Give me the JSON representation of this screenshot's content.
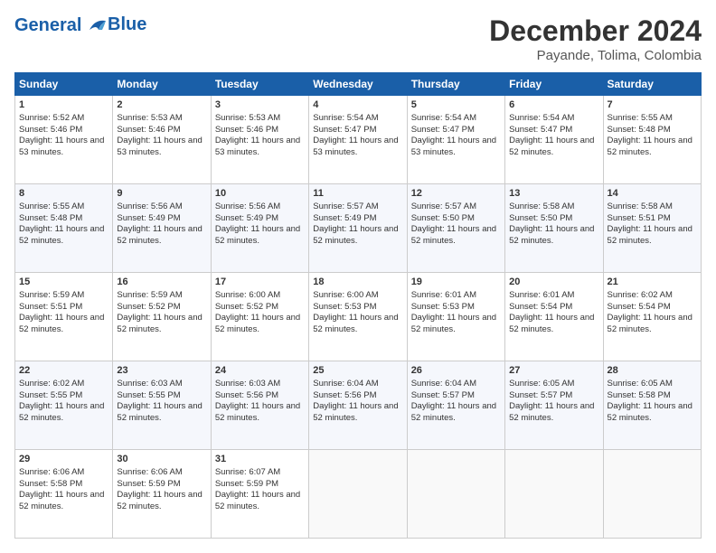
{
  "header": {
    "logo_line1": "General",
    "logo_line2": "Blue",
    "title": "December 2024",
    "subtitle": "Payande, Tolima, Colombia"
  },
  "days_of_week": [
    "Sunday",
    "Monday",
    "Tuesday",
    "Wednesday",
    "Thursday",
    "Friday",
    "Saturday"
  ],
  "weeks": [
    [
      {
        "day": "1",
        "sunrise": "5:52 AM",
        "sunset": "5:46 PM",
        "daylight": "11 hours and 53 minutes."
      },
      {
        "day": "2",
        "sunrise": "5:53 AM",
        "sunset": "5:46 PM",
        "daylight": "11 hours and 53 minutes."
      },
      {
        "day": "3",
        "sunrise": "5:53 AM",
        "sunset": "5:46 PM",
        "daylight": "11 hours and 53 minutes."
      },
      {
        "day": "4",
        "sunrise": "5:54 AM",
        "sunset": "5:47 PM",
        "daylight": "11 hours and 53 minutes."
      },
      {
        "day": "5",
        "sunrise": "5:54 AM",
        "sunset": "5:47 PM",
        "daylight": "11 hours and 53 minutes."
      },
      {
        "day": "6",
        "sunrise": "5:54 AM",
        "sunset": "5:47 PM",
        "daylight": "11 hours and 52 minutes."
      },
      {
        "day": "7",
        "sunrise": "5:55 AM",
        "sunset": "5:48 PM",
        "daylight": "11 hours and 52 minutes."
      }
    ],
    [
      {
        "day": "8",
        "sunrise": "5:55 AM",
        "sunset": "5:48 PM",
        "daylight": "11 hours and 52 minutes."
      },
      {
        "day": "9",
        "sunrise": "5:56 AM",
        "sunset": "5:49 PM",
        "daylight": "11 hours and 52 minutes."
      },
      {
        "day": "10",
        "sunrise": "5:56 AM",
        "sunset": "5:49 PM",
        "daylight": "11 hours and 52 minutes."
      },
      {
        "day": "11",
        "sunrise": "5:57 AM",
        "sunset": "5:49 PM",
        "daylight": "11 hours and 52 minutes."
      },
      {
        "day": "12",
        "sunrise": "5:57 AM",
        "sunset": "5:50 PM",
        "daylight": "11 hours and 52 minutes."
      },
      {
        "day": "13",
        "sunrise": "5:58 AM",
        "sunset": "5:50 PM",
        "daylight": "11 hours and 52 minutes."
      },
      {
        "day": "14",
        "sunrise": "5:58 AM",
        "sunset": "5:51 PM",
        "daylight": "11 hours and 52 minutes."
      }
    ],
    [
      {
        "day": "15",
        "sunrise": "5:59 AM",
        "sunset": "5:51 PM",
        "daylight": "11 hours and 52 minutes."
      },
      {
        "day": "16",
        "sunrise": "5:59 AM",
        "sunset": "5:52 PM",
        "daylight": "11 hours and 52 minutes."
      },
      {
        "day": "17",
        "sunrise": "6:00 AM",
        "sunset": "5:52 PM",
        "daylight": "11 hours and 52 minutes."
      },
      {
        "day": "18",
        "sunrise": "6:00 AM",
        "sunset": "5:53 PM",
        "daylight": "11 hours and 52 minutes."
      },
      {
        "day": "19",
        "sunrise": "6:01 AM",
        "sunset": "5:53 PM",
        "daylight": "11 hours and 52 minutes."
      },
      {
        "day": "20",
        "sunrise": "6:01 AM",
        "sunset": "5:54 PM",
        "daylight": "11 hours and 52 minutes."
      },
      {
        "day": "21",
        "sunrise": "6:02 AM",
        "sunset": "5:54 PM",
        "daylight": "11 hours and 52 minutes."
      }
    ],
    [
      {
        "day": "22",
        "sunrise": "6:02 AM",
        "sunset": "5:55 PM",
        "daylight": "11 hours and 52 minutes."
      },
      {
        "day": "23",
        "sunrise": "6:03 AM",
        "sunset": "5:55 PM",
        "daylight": "11 hours and 52 minutes."
      },
      {
        "day": "24",
        "sunrise": "6:03 AM",
        "sunset": "5:56 PM",
        "daylight": "11 hours and 52 minutes."
      },
      {
        "day": "25",
        "sunrise": "6:04 AM",
        "sunset": "5:56 PM",
        "daylight": "11 hours and 52 minutes."
      },
      {
        "day": "26",
        "sunrise": "6:04 AM",
        "sunset": "5:57 PM",
        "daylight": "11 hours and 52 minutes."
      },
      {
        "day": "27",
        "sunrise": "6:05 AM",
        "sunset": "5:57 PM",
        "daylight": "11 hours and 52 minutes."
      },
      {
        "day": "28",
        "sunrise": "6:05 AM",
        "sunset": "5:58 PM",
        "daylight": "11 hours and 52 minutes."
      }
    ],
    [
      {
        "day": "29",
        "sunrise": "6:06 AM",
        "sunset": "5:58 PM",
        "daylight": "11 hours and 52 minutes."
      },
      {
        "day": "30",
        "sunrise": "6:06 AM",
        "sunset": "5:59 PM",
        "daylight": "11 hours and 52 minutes."
      },
      {
        "day": "31",
        "sunrise": "6:07 AM",
        "sunset": "5:59 PM",
        "daylight": "11 hours and 52 minutes."
      },
      null,
      null,
      null,
      null
    ]
  ]
}
